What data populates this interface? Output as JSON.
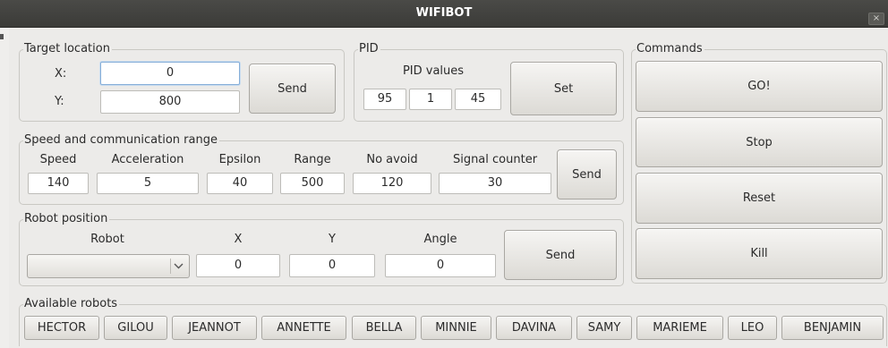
{
  "window": {
    "title": "WIFIBOT",
    "close_glyph": "×"
  },
  "target_location": {
    "legend": "Target location",
    "x_label": "X:",
    "y_label": "Y:",
    "x_value": "0",
    "y_value": "800",
    "send_label": "Send"
  },
  "pid": {
    "legend": "PID",
    "values_label": "PID values",
    "p": "95",
    "i": "1",
    "d": "45",
    "set_label": "Set"
  },
  "commands": {
    "legend": "Commands",
    "go_label": "GO!",
    "stop_label": "Stop",
    "reset_label": "Reset",
    "kill_label": "Kill"
  },
  "speed_range": {
    "legend": "Speed and communication range",
    "speed_label": "Speed",
    "acceleration_label": "Acceleration",
    "epsilon_label": "Epsilon",
    "range_label": "Range",
    "no_avoid_label": "No avoid",
    "signal_counter_label": "Signal counter",
    "speed": "140",
    "acceleration": "5",
    "epsilon": "40",
    "range": "500",
    "no_avoid": "120",
    "signal_counter": "30",
    "send_label": "Send"
  },
  "robot_position": {
    "legend": "Robot position",
    "robot_label": "Robot",
    "x_label": "X",
    "y_label": "Y",
    "angle_label": "Angle",
    "robot_selected": "",
    "x": "0",
    "y": "0",
    "angle": "0",
    "send_label": "Send"
  },
  "available_robots": {
    "legend": "Available robots",
    "robots": [
      "HECTOR",
      "GILOU",
      "JEANNOT",
      "ANNETTE",
      "BELLA",
      "MINNIE",
      "DAVINA",
      "SAMY",
      "MARIEME",
      "LEO",
      "BENJAMIN"
    ]
  }
}
